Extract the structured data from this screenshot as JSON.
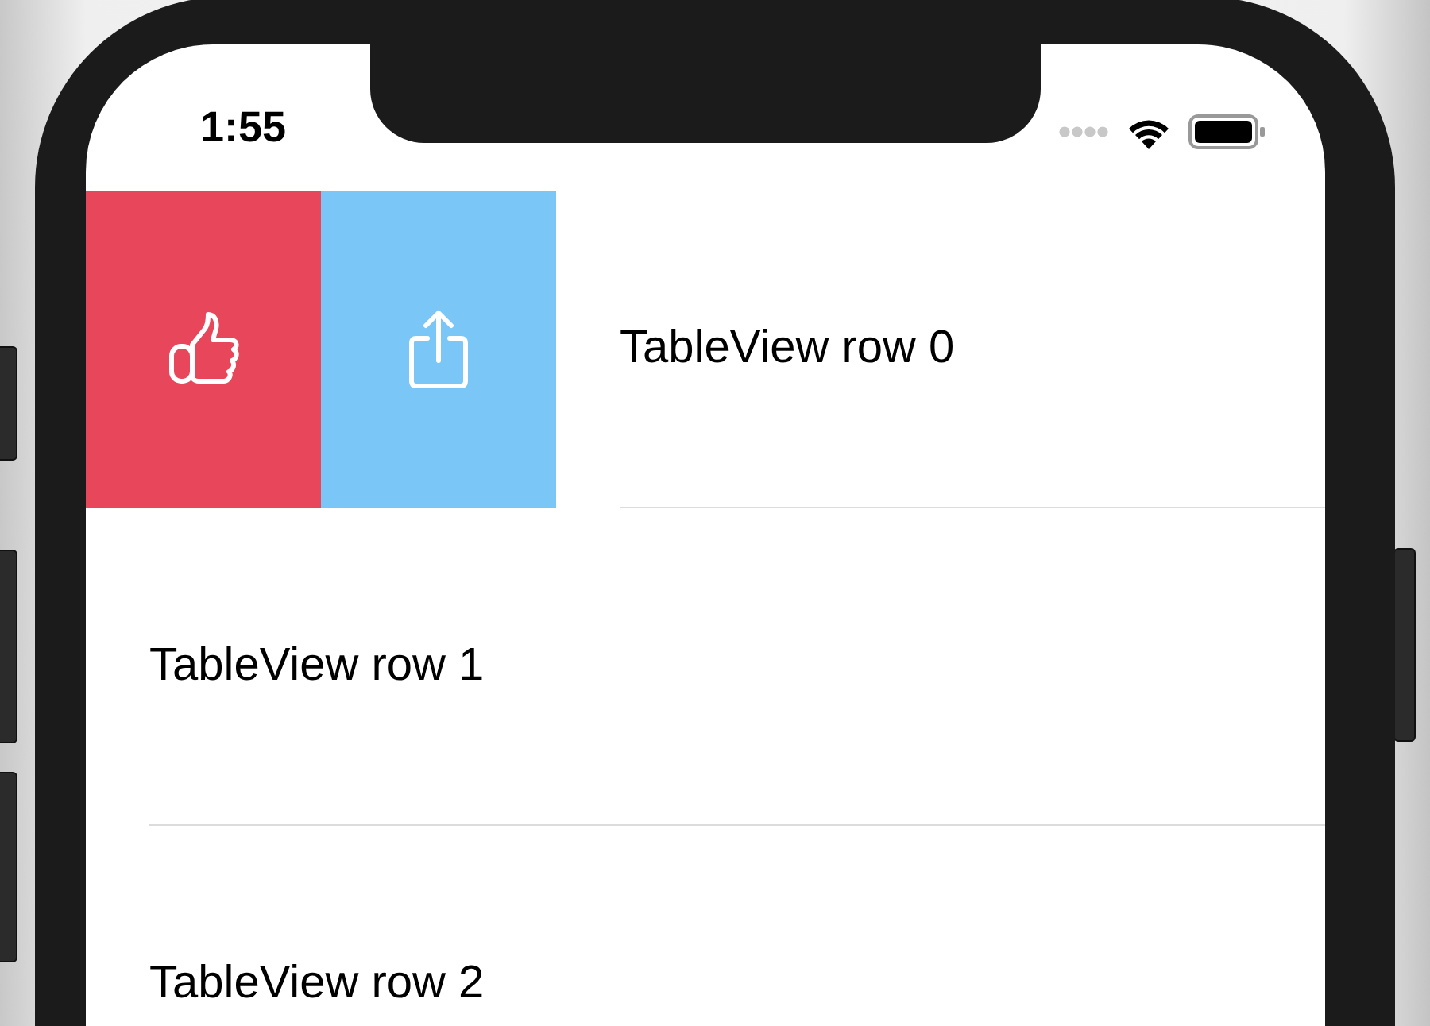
{
  "status_bar": {
    "time": "1:55"
  },
  "rows": [
    {
      "label": "TableView row 0",
      "actions": [
        {
          "kind": "like",
          "color": "#e8475b"
        },
        {
          "kind": "share",
          "color": "#7ac6f6"
        }
      ]
    },
    {
      "label": "TableView row 1"
    },
    {
      "label": "TableView row 2"
    }
  ]
}
